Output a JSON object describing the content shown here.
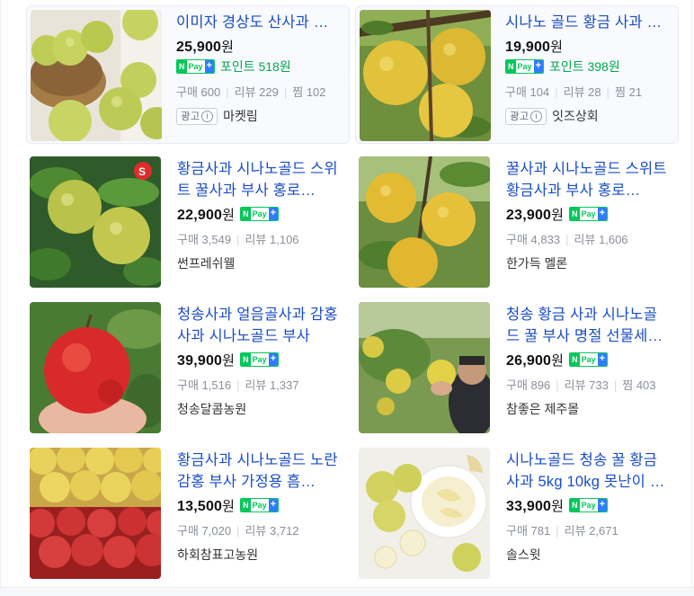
{
  "products": [
    {
      "title": "이미자 경상도 산사과 …",
      "price": "25,900",
      "won": "원",
      "npay": true,
      "point": "포인트 518원",
      "stats": [
        "구매 600",
        "리뷰 229",
        "찜 102"
      ],
      "ad_label": "광고",
      "ad_info": "i",
      "seller": "마켓림"
    },
    {
      "title": "시나노 골드 황금 사과 …",
      "price": "19,900",
      "won": "원",
      "npay": true,
      "point": "포인트 398원",
      "stats": [
        "구매 104",
        "리뷰 28",
        "찜 21"
      ],
      "ad_label": "광고",
      "ad_info": "i",
      "seller": "잇즈상회"
    },
    {
      "title": "황금사과 시나노골드 스위트 꿀사과 부사 홍로…",
      "price": "22,900",
      "won": "원",
      "npay": true,
      "stats": [
        "구매 3,549",
        "리뷰 1,106"
      ],
      "seller": "썬프레쉬웰"
    },
    {
      "title": "꿀사과 시나노골드 스위트 황금사과 부사 홍로…",
      "price": "23,900",
      "won": "원",
      "npay": true,
      "stats": [
        "구매 4,833",
        "리뷰 1,606"
      ],
      "seller": "한가득 멜론"
    },
    {
      "title": "청송사과 얼음골사과 감홍사과 시나노골드 부사",
      "price": "39,900",
      "won": "원",
      "npay": true,
      "stats": [
        "구매 1,516",
        "리뷰 1,337"
      ],
      "seller": "청송달콤농원"
    },
    {
      "title": "청송 황금 사과 시나노골드 꿀 부사 명절 선물세…",
      "price": "26,900",
      "won": "원",
      "npay": true,
      "stats": [
        "구매 896",
        "리뷰 733",
        "찜 403"
      ],
      "seller": "참좋은 제주몰"
    },
    {
      "title": "황금사과 시나노골드 노란 감홍 부사 가정용 흠…",
      "price": "13,500",
      "won": "원",
      "npay": true,
      "stats": [
        "구매 7,020",
        "리뷰 3,712"
      ],
      "seller": "하회참표고농원"
    },
    {
      "title": "시나노골드 청송 꿀 황금사과 5kg 10kg 못난이 …",
      "price": "33,900",
      "won": "원",
      "npay": true,
      "stats": [
        "구매 781",
        "리뷰 2,671"
      ],
      "seller": "솔스윗"
    }
  ],
  "npay_badge": {
    "n": "N",
    "pay": "Pay",
    "plus": "+"
  },
  "colors": {
    "title": "#1a4cc8",
    "npay_green": "#03c75a",
    "point_green": "#03a94d",
    "plus_blue": "#2f7dff"
  },
  "images": [
    "green-apples-in-basket",
    "yellow-apples-on-branch",
    "green-yellow-apple-on-tree-with-logo",
    "yellow-apples-on-tree",
    "red-apple-in-hand",
    "farmer-holding-yellow-apple",
    "crate-of-yellow-and-red-apples",
    "sliced-yellow-apples-on-plate"
  ]
}
